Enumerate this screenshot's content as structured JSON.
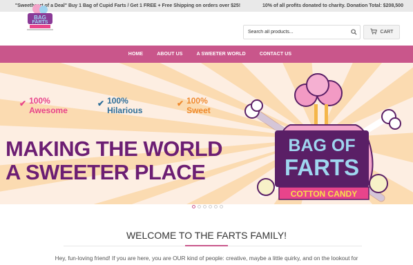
{
  "announcement": {
    "left": "\"Sweetheart of a Deal\" Buy 1 Bag of Cupid Farts / Get 1 FREE + Free Shipping on orders over $25!",
    "right": "10% of all profits donated to charity. Donation Total: $208,500"
  },
  "search": {
    "placeholder": "Search all products..."
  },
  "cart": {
    "label": "CART"
  },
  "nav": [
    "HOME",
    "ABOUT US",
    "A SWEETER WORLD",
    "CONTACT US"
  ],
  "hero": {
    "features": [
      {
        "pct": "100%",
        "word": "Awesome",
        "color": "#e8448b"
      },
      {
        "pct": "100%",
        "word": "Hilarious",
        "color": "#2f6f99"
      },
      {
        "pct": "100%",
        "word": "Sweet",
        "color": "#ef8a2d"
      }
    ],
    "headline_1": "MAKING THE WORLD",
    "headline_2": "A SWEETER PLACE",
    "product_line1": "BAG OF",
    "product_line2": "FARTS",
    "product_sub": "COTTON CANDY"
  },
  "slides": 6,
  "welcome": {
    "title": "WELCOME TO THE FARTS FAMILY!",
    "text": "Hey, fun-loving friend! If you are here, you are OUR kind of people: creative, maybe a little quirky, and on the lookout for"
  },
  "colors": {
    "accent": "#c9568b",
    "headline": "#6c1e73"
  }
}
